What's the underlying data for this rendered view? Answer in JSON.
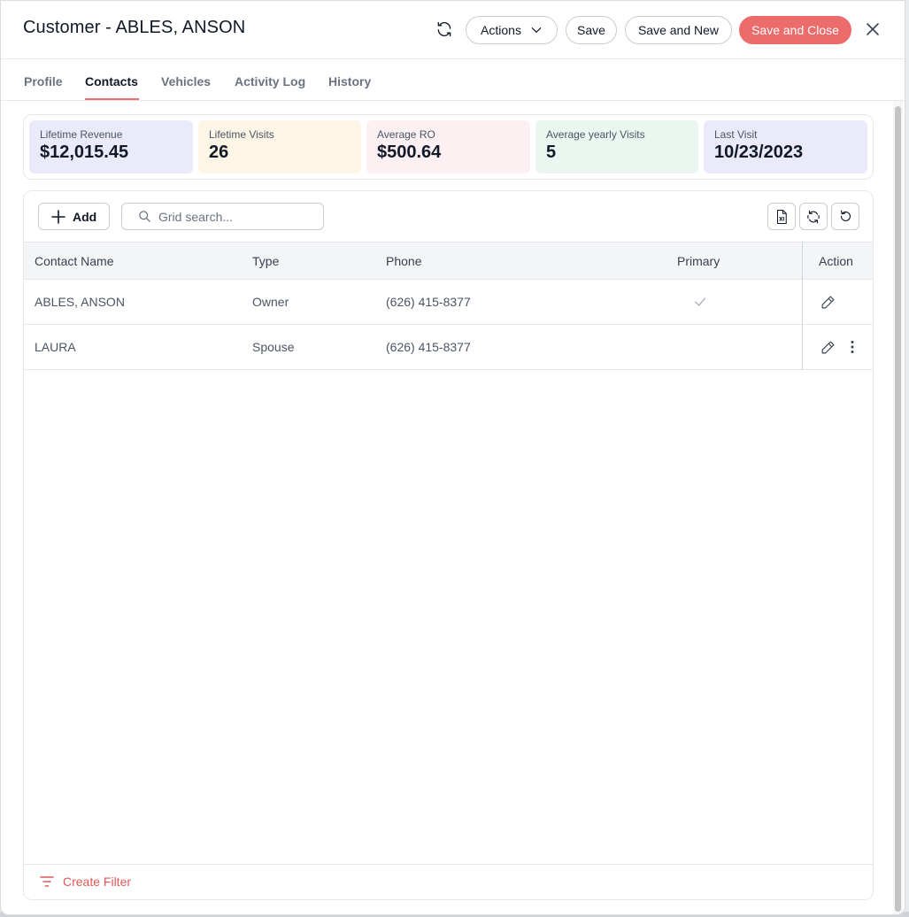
{
  "window": {
    "title": "Customer - ABLES, ANSON"
  },
  "toolbar": {
    "actions_label": "Actions",
    "save_label": "Save",
    "save_new_label": "Save and New",
    "save_close_label": "Save and Close"
  },
  "tabs": [
    {
      "label": "Profile"
    },
    {
      "label": "Contacts"
    },
    {
      "label": "Vehicles"
    },
    {
      "label": "Activity Log"
    },
    {
      "label": "History"
    }
  ],
  "active_tab": "Contacts",
  "stats": [
    {
      "label": "Lifetime Revenue",
      "value": "$12,015.45",
      "color": "#ebeafb"
    },
    {
      "label": "Lifetime Visits",
      "value": "26",
      "color": "#fdf6e7"
    },
    {
      "label": "Average RO",
      "value": "$500.64",
      "color": "#fdf0f3"
    },
    {
      "label": "Average yearly Visits",
      "value": "5",
      "color": "#eaf6ef"
    },
    {
      "label": "Last Visit",
      "value": "10/23/2023",
      "color": "#ebeafb"
    }
  ],
  "grid": {
    "add_label": "Add",
    "search_placeholder": "Grid search...",
    "columns": {
      "name": "Contact Name",
      "type": "Type",
      "phone": "Phone",
      "primary": "Primary",
      "action": "Action"
    },
    "rows": [
      {
        "name": "ABLES, ANSON",
        "type": "Owner",
        "phone": "(626) 415-8377",
        "primary": true
      },
      {
        "name": "LAURA",
        "type": "Spouse",
        "phone": "(626) 415-8377",
        "primary": false
      }
    ],
    "create_filter_label": "Create Filter"
  },
  "colors": {
    "accent": "#ec6b6b",
    "filter_text": "#e05858"
  }
}
